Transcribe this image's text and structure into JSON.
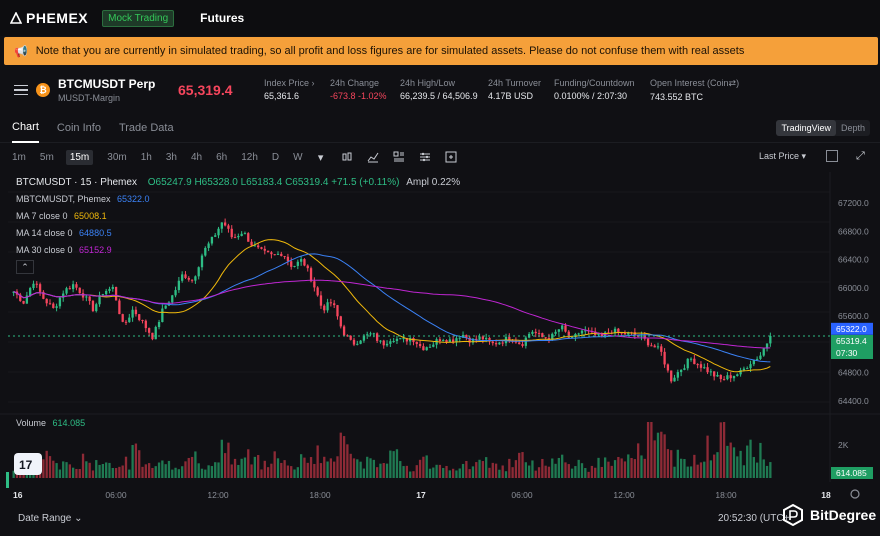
{
  "nav": {
    "brand": "PHEMEX",
    "mock_badge": "Mock Trading",
    "futures": "Futures"
  },
  "banner": {
    "text": "Note that you are currently in simulated trading, so all profit and loss figures are for simulated assets. Please do not confuse them with real assets"
  },
  "ticker": {
    "symbol": "BTCMUSDT Perp",
    "sub": "MUSDT-Margin",
    "coin_glyph": "₿",
    "last_price": "65,319.4",
    "stats": [
      {
        "label": "Index Price ›",
        "value": "65,361.6",
        "red": false
      },
      {
        "label": "24h Change",
        "value": "-673.8 -1.02%",
        "red": true
      },
      {
        "label": "24h High/Low",
        "value": "66,239.5 / 64,506.9",
        "red": false
      },
      {
        "label": "24h Turnover",
        "value": "4.17B USD",
        "red": false
      },
      {
        "label": "Funding/Countdown",
        "value": "0.0100% / 2:07:30",
        "red": false
      },
      {
        "label": "Open Interest (Coin⇄)",
        "value": "743.552 BTC",
        "red": false
      }
    ]
  },
  "tabs": [
    "Chart",
    "Coin Info",
    "Trade Data"
  ],
  "view_toggle": [
    "TradingView",
    "Depth"
  ],
  "intervals": [
    "1m",
    "5m",
    "15m",
    "30m",
    "1h",
    "3h",
    "4h",
    "6h",
    "12h",
    "D",
    "W"
  ],
  "last_price_select": "Last Price ▾",
  "legend": {
    "symbol": "BTCMUSDT · 15 · Phemex",
    "ohlc": "O65247.9 H65328.0 L65183.4 C65319.4 +71.5 (+0.11%)",
    "ampl": "Ampl 0.22%",
    "index_label": "MBTCMUSDT, Phemex",
    "index_val": "65322.0",
    "ma7_label": "MA 7 close 0",
    "ma7_val": "65008.1",
    "ma14_label": "MA 14 close 0",
    "ma14_val": "64880.5",
    "ma30_label": "MA 30 close 0",
    "ma30_val": "65152.9",
    "volume_label": "Volume",
    "volume_val": "614.085"
  },
  "axis": {
    "price_ticks": [
      "67200.0",
      "66800.0",
      "66400.0",
      "66000.0",
      "65600.0",
      "64800.0",
      "64400.0"
    ],
    "index_tag": "65322.0",
    "last_tag": "65319.4",
    "countdown_tag": "07:30",
    "volume_tick": "2K",
    "volume_tag": "614.085",
    "time_ticks": [
      "16",
      "06:00",
      "12:00",
      "18:00",
      "17",
      "06:00",
      "12:00",
      "18:00",
      "18"
    ]
  },
  "footer": {
    "date_range": "Date Range ⌄",
    "clock": "20:52:30 (UTC+",
    "watermark": "BitDegree"
  },
  "colors": {
    "up": "#2ebd85",
    "down": "#f6465d",
    "ma7": "#f0b90b",
    "ma14": "#3b82f6",
    "ma30": "#c026d3",
    "banner": "#f5a03a"
  },
  "chart_data": {
    "type": "candlestick",
    "title": "BTCMUSDT · 15 · Phemex",
    "ylim": [
      64300,
      67500
    ],
    "x_ticks": [
      "16",
      "06:00",
      "12:00",
      "18:00",
      "17",
      "06:00",
      "12:00",
      "18:00",
      "18"
    ],
    "close_path": [
      65950,
      65800,
      66100,
      65850,
      65700,
      65950,
      66050,
      65900,
      65700,
      65950,
      66000,
      65450,
      65700,
      65500,
      65300,
      65700,
      65900,
      66200,
      66100,
      66500,
      66700,
      66950,
      66700,
      66800,
      66600,
      66500,
      66450,
      66500,
      66300,
      66400,
      66100,
      65700,
      65800,
      65400,
      65200,
      65300,
      65350,
      65200,
      65300,
      65250,
      65300,
      65150,
      65200,
      65300,
      65250,
      65350,
      65250,
      65300,
      65200,
      65250,
      65300,
      65200,
      65400,
      65300,
      65300,
      65450,
      65250,
      65400,
      65350,
      65300,
      65400,
      65350,
      65350,
      65300,
      65200,
      65100,
      64700,
      64850,
      65000,
      64900,
      64800,
      64700,
      64750,
      64800,
      64950,
      65050,
      65319
    ],
    "volume_level": [
      0.15,
      0.3,
      0.2,
      0.5,
      0.25,
      0.3,
      0.2,
      0.35,
      0.25,
      0.4,
      0.2,
      0.3,
      0.5,
      0.25,
      0.3,
      0.4,
      0.2,
      0.3,
      0.45,
      0.3,
      0.25,
      0.6,
      0.3,
      0.4,
      0.35,
      0.3,
      0.5,
      0.3,
      0.2,
      0.35,
      0.5,
      0.4,
      0.3,
      0.95,
      0.6,
      0.3,
      0.35,
      0.25,
      0.4,
      0.3,
      0.2,
      0.35,
      0.25,
      0.3,
      0.2,
      0.3,
      0.25,
      0.3,
      0.35,
      0.2,
      0.3,
      0.4,
      0.25,
      0.3,
      0.35,
      0.4,
      0.25,
      0.3,
      0.2,
      0.3,
      0.35,
      0.3,
      0.4,
      0.5,
      0.95,
      0.7,
      0.4,
      0.5,
      0.4,
      0.3,
      0.6,
      0.9,
      0.5,
      0.4,
      0.6,
      0.5,
      0.3
    ]
  }
}
